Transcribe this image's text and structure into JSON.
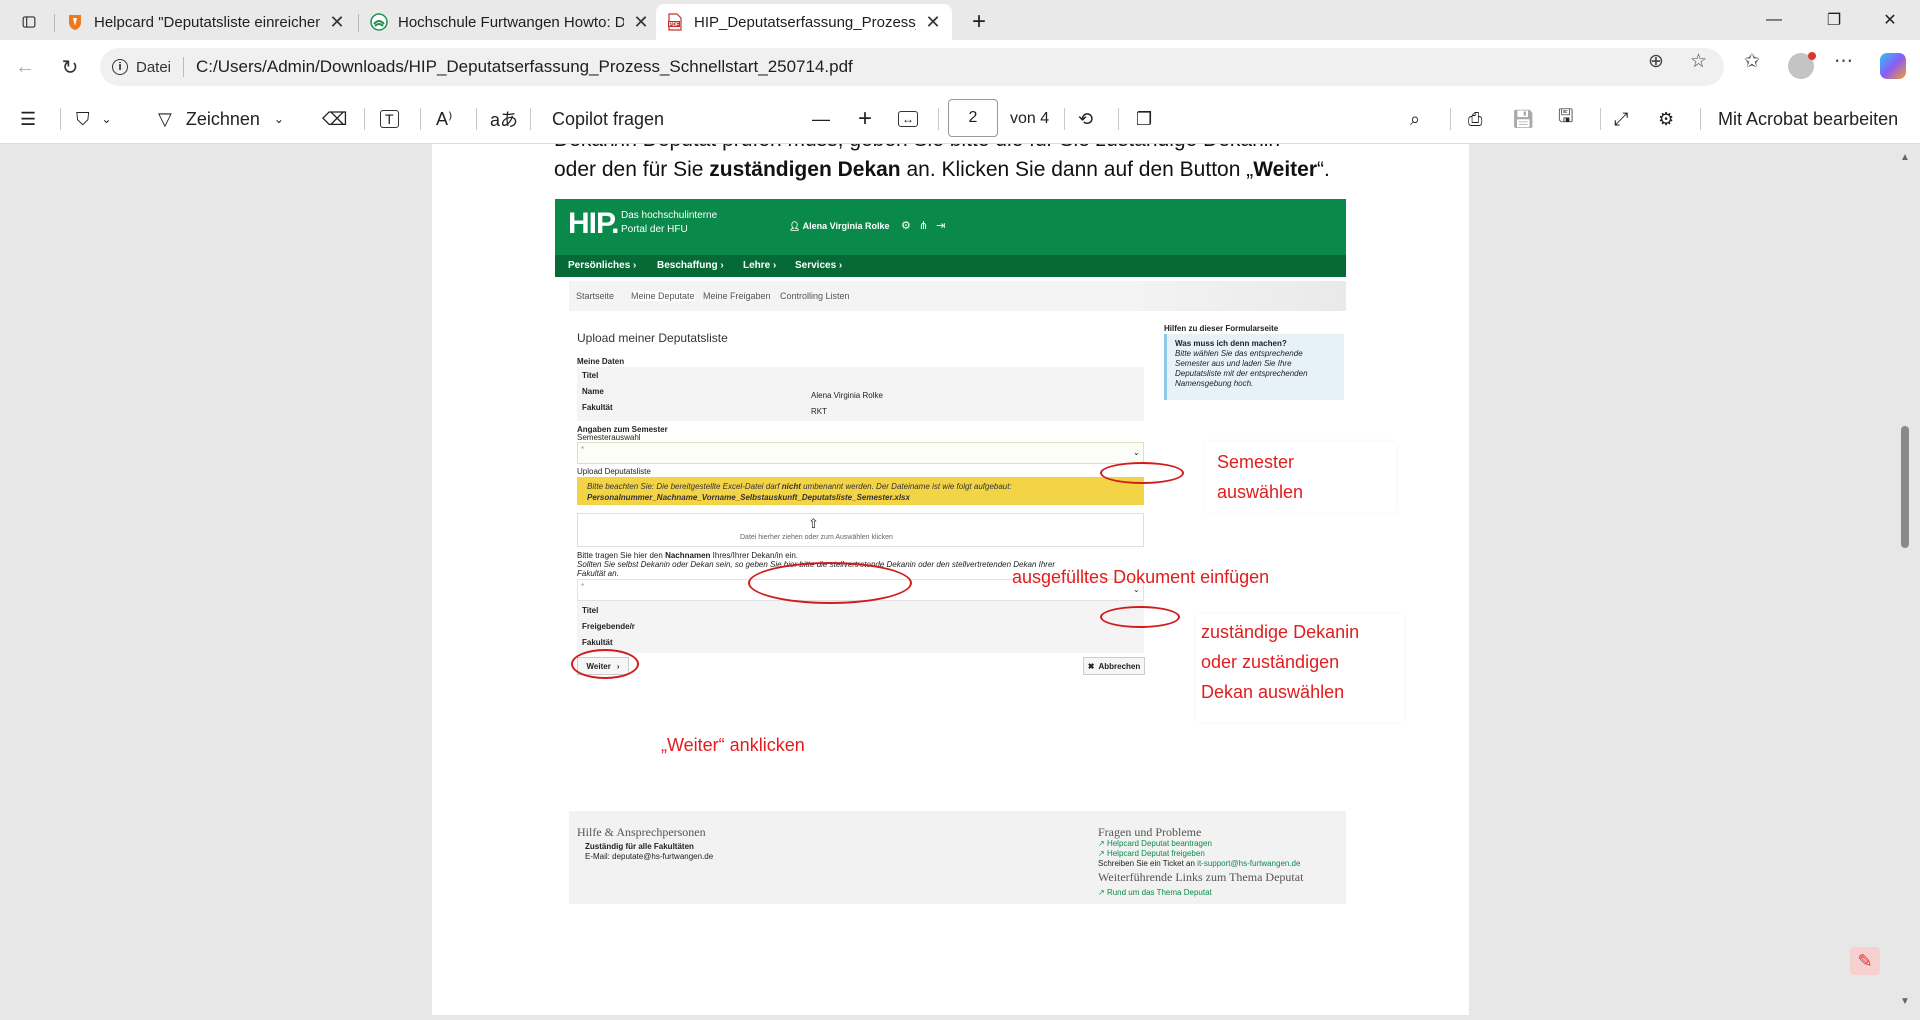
{
  "tabs": [
    {
      "title": "Helpcard \"Deputatsliste einreichen\"",
      "icon": "shield-icon",
      "active": false
    },
    {
      "title": "Hochschule Furtwangen Howto: D",
      "icon": "hfu-logo-icon",
      "active": false
    },
    {
      "title": "HIP_Deputatserfassung_Prozess_S",
      "icon": "pdf-icon",
      "active": true
    }
  ],
  "address": {
    "scheme_label": "Datei",
    "url": "C:/Users/Admin/Downloads/HIP_Deputatserfassung_Prozess_Schnellstart_250714.pdf"
  },
  "pdf_toolbar": {
    "draw_label": "Zeichnen",
    "copilot_label": "Copilot fragen",
    "page_current": "2",
    "page_total_label": "von 4",
    "acrobat_label": "Mit Acrobat bearbeiten"
  },
  "document": {
    "line_1": "Dekan/in Deputat prüfen muss, geben Sie bitte die für Sie zuständige Dekanin",
    "line_2_pre": "oder den für Sie ",
    "line_2_bold": "zuständigen Dekan",
    "line_2_mid": " an. Klicken Sie dann auf den Button „",
    "line_2_bold2": "Weiter",
    "line_2_post": "“."
  },
  "hip": {
    "logo": "HIP.",
    "subtitle_1": "Das hochschulinterne",
    "subtitle_2": "Portal der HFU",
    "user": "Alena Virginia Rolke",
    "nav": [
      "Persönliches ›",
      "Beschaffung ›",
      "Lehre ›",
      "Services ›"
    ],
    "tabs": [
      "Startseite",
      "Meine Deputate",
      "Meine Freigaben",
      "Controlling Listen"
    ],
    "page_title": "Upload meiner Deputatsliste",
    "meine_daten": "Meine Daten",
    "titel_label": "Titel",
    "name_label": "Name",
    "name_value": "Alena Virginia Rolke",
    "fakultaet_label": "Fakultät",
    "fakultaet_value": "RKT",
    "semester_heading": "Angaben zum Semester",
    "semester_label": "Semesterauswahl",
    "select_placeholder": "*",
    "upload_label": "Upload Deputatsliste",
    "warn_1_pre": "Bitte beachten Sie: Die bereitgestellte Excel-Datei darf ",
    "warn_1_bold": "nicht",
    "warn_1_post": " umbenannt werden. Der Dateiname ist wie folgt aufgebaut:",
    "warn_2": "Personalnummer_Nachname_Vorname_Selbstauskunft_Deputatsliste_Semester.xlsx",
    "drop_text": "Datei hierher ziehen oder zum Auswählen klicken",
    "dekan_1_pre": "Bitte tragen Sie hier den ",
    "dekan_1_bold": "Nachnamen",
    "dekan_1_post": " Ihres/Ihrer Dekan/in ein.",
    "dekan_2": "Sollten Sie selbst Dekanin oder Dekan sein, so geben Sie hier bitte die stellvertretende Dekanin oder den stellvertretenden Dekan Ihrer",
    "dekan_3": "Fakultät an.",
    "dekan_titel": "Titel",
    "freigebende": "Freigebende/r",
    "dekan_fakultaet": "Fakultät",
    "weiter": "Weiter",
    "abbrechen": "Abbrechen",
    "help_heading": "Hilfen zu dieser Formularseite",
    "help_q": "Was muss ich denn machen?",
    "help_text": "Bitte wählen Sie das entsprechende Semester aus und laden Sie Ihre Deputatsliste mit der entsprechenden Namensgebung hoch.",
    "footer": {
      "left_heading": "Hilfe & Ansprechpersonen",
      "left_bold": "Zuständig für alle Fakultäten",
      "left_mail": "E-Mail: deputate@hs-furtwangen.de",
      "right_heading": "Fragen und Probleme",
      "link_1": "Helpcard Deputat beantragen",
      "link_2": "Helpcard Deputat freigeben",
      "ticket_pre": "Schreiben Sie ein Ticket an ",
      "ticket_mail": "it-support@hs-furtwangen.de",
      "right_heading_2": "Weiterführende Links zum Thema Deputat",
      "link_3": "Rund um das Thema Deputat"
    }
  },
  "annotations": {
    "semester_1": "Semester",
    "semester_2": "auswählen",
    "dokument": "ausgefülltes Dokument einfügen",
    "dekan_1": "zuständige Dekanin",
    "dekan_2": "oder zuständigen",
    "dekan_3": "Dekan auswählen",
    "weiter": "„Weiter“ anklicken"
  },
  "colors": {
    "hip_green": "#0a8a4a",
    "annotation_red": "#e11d1d",
    "warning_yellow": "#f3d447"
  }
}
